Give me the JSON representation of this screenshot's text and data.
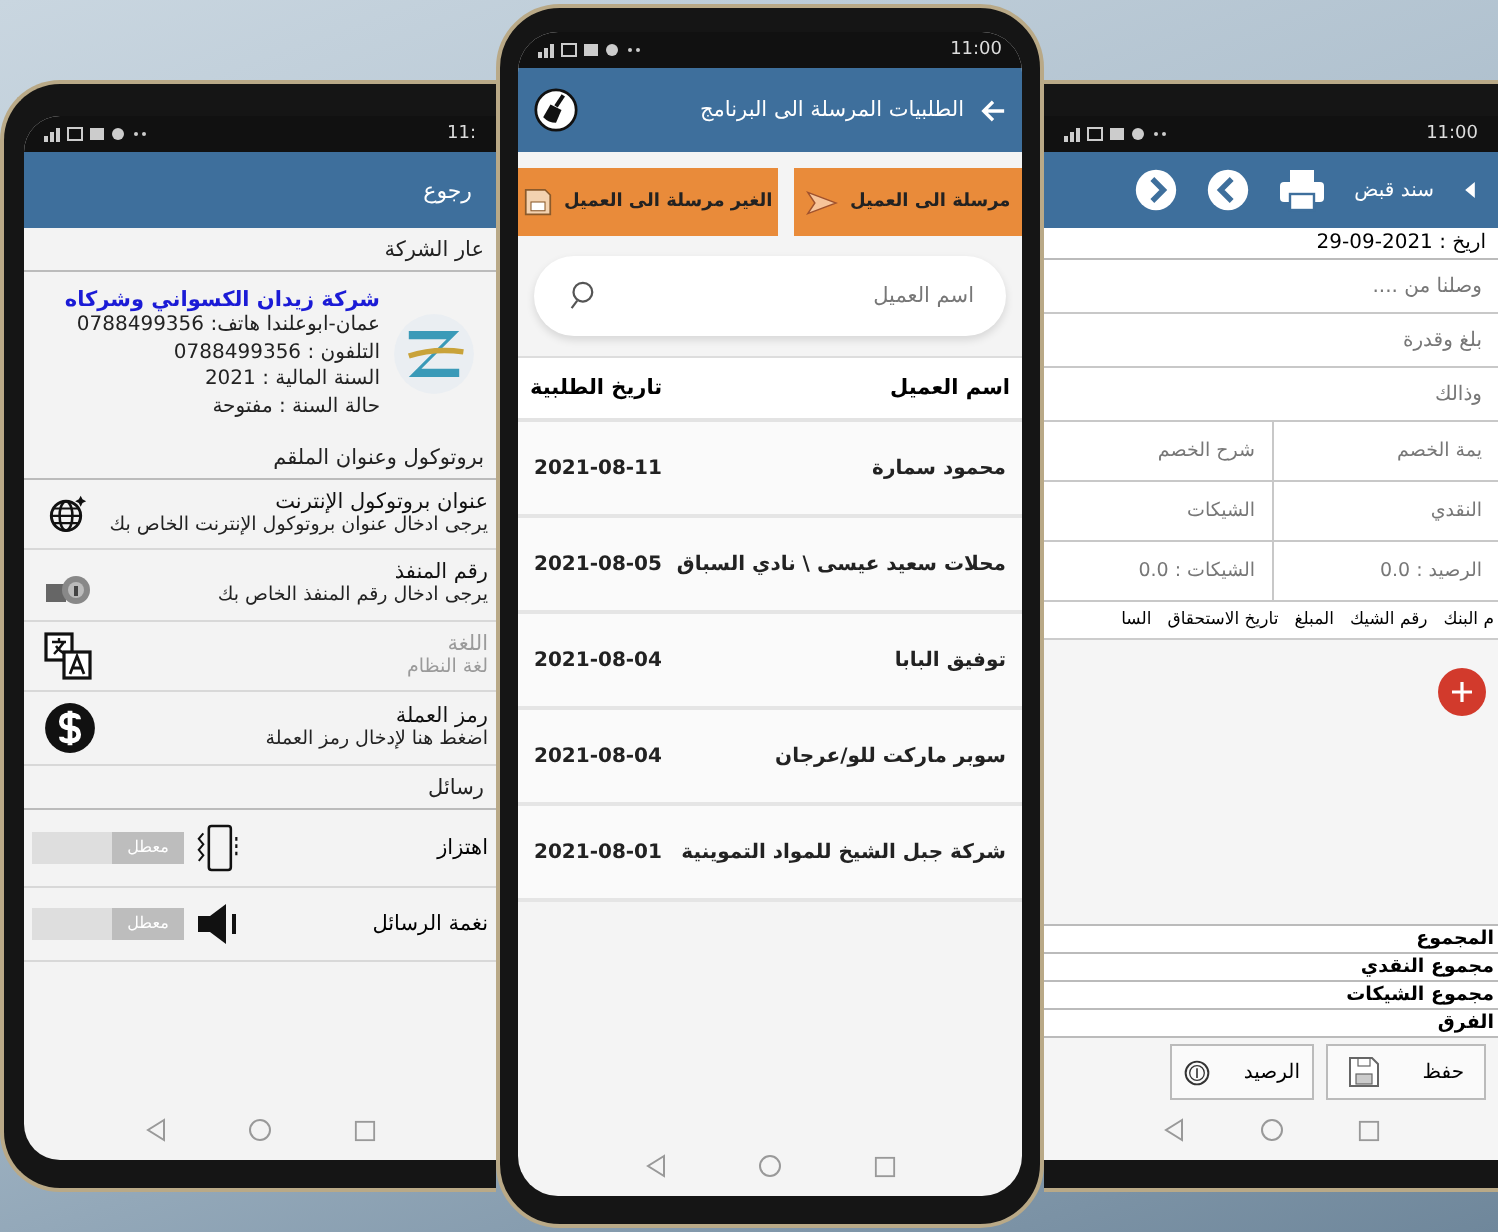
{
  "settings_screen": {
    "status_time": "11:",
    "back_label": "رجوع",
    "company_section": "عار الشركة",
    "company": {
      "name": "شركة زيدان الكسواني وشركاه",
      "lines": [
        "عمان-ابوعلندا هاتف: 0788499356",
        "التلفون : 0788499356",
        "السنة المالية : 2021",
        "حالة السنة : مفتوحة"
      ]
    },
    "server_section": "بروتوكول وعنوان الملقم",
    "server_items": [
      {
        "kind": "globe",
        "title": "عنوان بروتوكول الإنترنت",
        "subtitle": "يرجى ادخال عنوان بروتوكول الإنترنت الخاص بك",
        "disabled": false
      },
      {
        "kind": "lock",
        "title": "رقم المنفذ",
        "subtitle": "يرجى ادخال رقم المنفذ الخاص بك",
        "disabled": false
      },
      {
        "kind": "language",
        "title": "اللغة",
        "subtitle": "لغة النظام",
        "disabled": true
      },
      {
        "kind": "currency",
        "title": "رمز العملة",
        "subtitle": "اضغط هنا لإدخال رمز العملة",
        "disabled": false
      }
    ],
    "messages_section": "رسائل",
    "message_items": [
      {
        "kind": "vibrate",
        "title": "اهتزاز",
        "toggle_label": "معطل",
        "on": false
      },
      {
        "kind": "speaker",
        "title": "نغمة الرسائل",
        "toggle_label": "معطل",
        "on": false
      }
    ]
  },
  "orders_screen": {
    "status_time": "11:00",
    "title": "الطلبيات المرسلة الى البرنامج",
    "filter_buttons": [
      {
        "kind": "sent",
        "label": "مرسلة الى العميل"
      },
      {
        "kind": "unsent",
        "label": "الغير مرسلة الى العميل"
      }
    ],
    "search": {
      "placeholder": "اسم العميل"
    },
    "columns": [
      "اسم العميل",
      "تاريخ الطلبية"
    ],
    "rows": [
      {
        "customer": "محمود سمارة",
        "date": "2021-08-11"
      },
      {
        "customer": "محلات سعيد عيسى \\ نادي السباق",
        "date": "2021-08-05"
      },
      {
        "customer": "توفيق البابا",
        "date": "2021-08-04"
      },
      {
        "customer": "سوبر ماركت للو/عرجان",
        "date": "2021-08-04"
      },
      {
        "customer": "شركة جبل الشيخ للمواد التموينية",
        "date": "2021-08-01"
      }
    ]
  },
  "receipt_screen": {
    "status_time": "11:00",
    "title": "سند قبض",
    "date_line": "اريخ : 2021-09-29",
    "fields": [
      {
        "placeholder": "وصلنا من ...."
      },
      {
        "placeholder": "بلغ وقدرة"
      },
      {
        "placeholder": "وذالك"
      }
    ],
    "pair_fields": [
      {
        "placeholder": "يمة الخصم"
      },
      {
        "placeholder": "شرح الخصم"
      },
      {
        "placeholder": "النقدي"
      },
      {
        "placeholder": "الشيكات"
      },
      {
        "placeholder": "الرصيد : 0.0"
      },
      {
        "placeholder": "الشيكات : 0.0"
      }
    ],
    "check_columns": [
      "م البنك",
      "رقم الشيك",
      "المبلغ",
      "تاريخ الاستحقاق",
      "السا"
    ],
    "totals": [
      "المجموع",
      "مجموع النقدي",
      "مجموع الشيكات",
      "الفرق"
    ],
    "buttons": [
      {
        "kind": "save",
        "label": "حفظ"
      },
      {
        "kind": "balance",
        "label": "الرصيد"
      }
    ]
  }
}
